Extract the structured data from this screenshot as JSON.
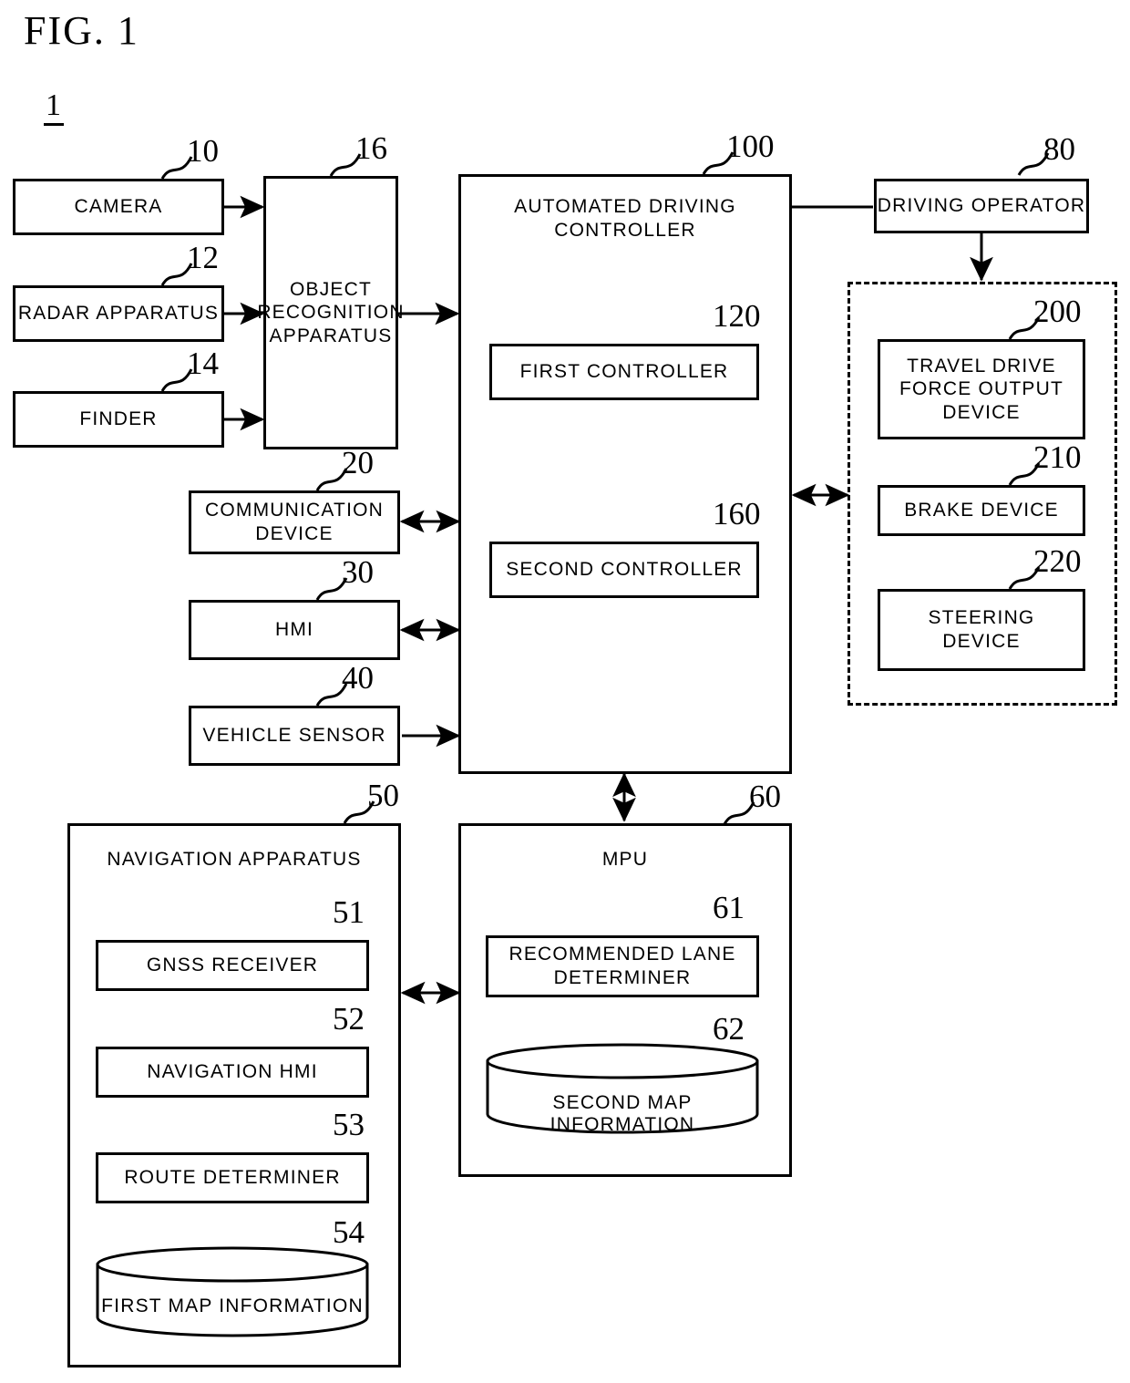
{
  "figure": {
    "title": "FIG. 1",
    "system_ref": "1"
  },
  "blocks": {
    "camera": {
      "label": "CAMERA",
      "ref": "10"
    },
    "radar": {
      "label": "RADAR APPARATUS",
      "ref": "12"
    },
    "finder": {
      "label": "FINDER",
      "ref": "14"
    },
    "object_recognition": {
      "label": "OBJECT\nRECOGNITION\nAPPARATUS",
      "ref": "16"
    },
    "communication": {
      "label": "COMMUNICATION\nDEVICE",
      "ref": "20"
    },
    "hmi": {
      "label": "HMI",
      "ref": "30"
    },
    "vehicle_sensor": {
      "label": "VEHICLE SENSOR",
      "ref": "40"
    },
    "automated_driving": {
      "label": "AUTOMATED DRIVING\nCONTROLLER",
      "ref": "100"
    },
    "first_controller": {
      "label": "FIRST CONTROLLER",
      "ref": "120"
    },
    "second_controller": {
      "label": "SECOND CONTROLLER",
      "ref": "160"
    },
    "driving_operator": {
      "label": "DRIVING OPERATOR",
      "ref": "80"
    },
    "travel_drive": {
      "label": "TRAVEL DRIVE\nFORCE OUTPUT\nDEVICE",
      "ref": "200"
    },
    "brake_device": {
      "label": "BRAKE DEVICE",
      "ref": "210"
    },
    "steering_device": {
      "label": "STEERING\nDEVICE",
      "ref": "220"
    },
    "navigation": {
      "label": "NAVIGATION APPARATUS",
      "ref": "50"
    },
    "gnss_receiver": {
      "label": "GNSS RECEIVER",
      "ref": "51"
    },
    "navigation_hmi": {
      "label": "NAVIGATION HMI",
      "ref": "52"
    },
    "route_determiner": {
      "label": "ROUTE DETERMINER",
      "ref": "53"
    },
    "first_map": {
      "label": "FIRST MAP INFORMATION",
      "ref": "54"
    },
    "mpu": {
      "label": "MPU",
      "ref": "60"
    },
    "recommended_lane": {
      "label": "RECOMMENDED LANE\nDETERMINER",
      "ref": "61"
    },
    "second_map": {
      "label": "SECOND MAP INFORMATION",
      "ref": "62"
    }
  },
  "connections": [
    {
      "name": "camera-to-object-recognition",
      "from": "camera",
      "to": "object_recognition",
      "arrow": "single"
    },
    {
      "name": "radar-to-object-recognition",
      "from": "radar",
      "to": "object_recognition",
      "arrow": "single"
    },
    {
      "name": "finder-to-object-recognition",
      "from": "finder",
      "to": "object_recognition",
      "arrow": "single"
    },
    {
      "name": "object-recognition-to-controller",
      "from": "object_recognition",
      "to": "automated_driving",
      "arrow": "single"
    },
    {
      "name": "communication-to-controller",
      "from": "communication",
      "to": "automated_driving",
      "arrow": "double"
    },
    {
      "name": "hmi-to-controller",
      "from": "hmi",
      "to": "automated_driving",
      "arrow": "double"
    },
    {
      "name": "vehicle-sensor-to-controller",
      "from": "vehicle_sensor",
      "to": "automated_driving",
      "arrow": "single"
    },
    {
      "name": "driving-operator-to-controller",
      "from": "driving_operator",
      "to": "automated_driving",
      "arrow": "single"
    },
    {
      "name": "driving-operator-to-actuators",
      "from": "driving_operator",
      "to": "travel_drive",
      "arrow": "single"
    },
    {
      "name": "controller-to-actuators",
      "from": "automated_driving",
      "to": "travel_drive",
      "arrow": "double"
    },
    {
      "name": "controller-to-mpu",
      "from": "automated_driving",
      "to": "mpu",
      "arrow": "double"
    },
    {
      "name": "navigation-to-mpu",
      "from": "navigation",
      "to": "mpu",
      "arrow": "double"
    }
  ],
  "colors": {
    "stroke": "#000000",
    "background": "#ffffff"
  }
}
